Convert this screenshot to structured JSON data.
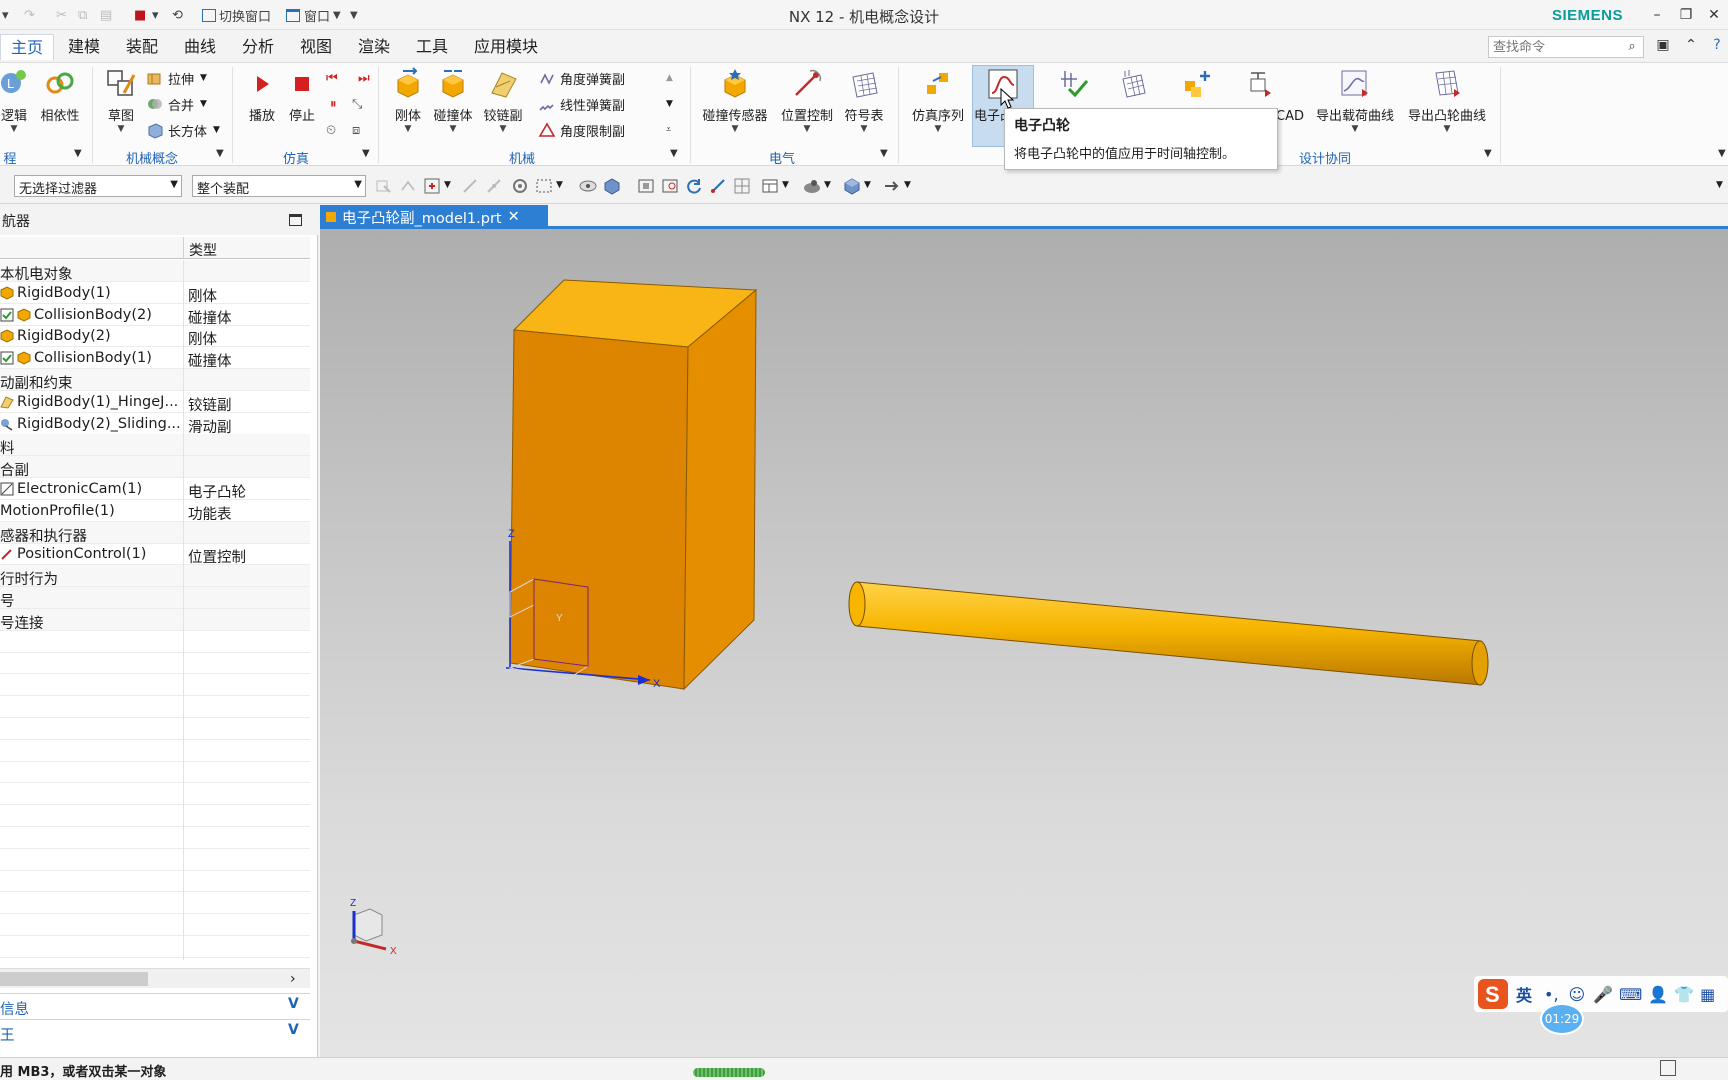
{
  "titlebar": {
    "app_title": "NX 12 - 机电概念设计",
    "brand": "SIEMENS",
    "switch_window_label": "切换窗口",
    "window_menu_label": "窗口"
  },
  "menu": {
    "tabs": [
      "主页",
      "建模",
      "装配",
      "曲线",
      "分析",
      "视图",
      "渲染",
      "工具",
      "应用模块"
    ],
    "active": "主页",
    "search_placeholder": "查找命令"
  },
  "ribbon": {
    "logic_label": "逻辑",
    "coupling_label": "相依性",
    "group_process": "程",
    "sketch_label": "草图",
    "extrude_label": "拉伸",
    "unite_label": "合并",
    "block_label": "长方体",
    "group_mech_concept": "机械概念",
    "play_label": "播放",
    "stop_label": "停止",
    "group_sim": "仿真",
    "rigid_label": "刚体",
    "collision_label": "碰撞体",
    "hinge_label": "铰链副",
    "angular_spring_label": "角度弹簧副",
    "linear_spring_label": "线性弹簧副",
    "angle_limit_label": "角度限制副",
    "group_mech": "机械",
    "collision_sensor_label": "碰撞传感器",
    "position_control_label": "位置控制",
    "symbol_table_label": "符号表",
    "group_elec": "电气",
    "sim_sequence_label": "仿真序列",
    "electronic_cam_label": "电子凸轮",
    "cad_label": "CAD",
    "export_load_curve_label": "导出载荷曲线",
    "export_cam_curve_label": "导出凸轮曲线",
    "group_design_collab": "设计协同"
  },
  "tooltip": {
    "title": "电子凸轮",
    "text": "将电子凸轮中的值应用于时间轴控制。"
  },
  "filterbar": {
    "filter_value": "无选择过滤器",
    "scope_value": "整个装配"
  },
  "navigator": {
    "title": "航器",
    "col_type": "类型",
    "rows": [
      {
        "name": "本机电对象",
        "type": "",
        "kind": "group"
      },
      {
        "name": "RigidBody(1)",
        "type": "刚体",
        "kind": "rigid"
      },
      {
        "name": "CollisionBody(2)",
        "type": "碰撞体",
        "kind": "collision"
      },
      {
        "name": "RigidBody(2)",
        "type": "刚体",
        "kind": "rigid"
      },
      {
        "name": "CollisionBody(1)",
        "type": "碰撞体",
        "kind": "collision"
      },
      {
        "name": "动副和约束",
        "type": "",
        "kind": "group"
      },
      {
        "name": "RigidBody(1)_HingeJ...",
        "type": "铰链副",
        "kind": "hinge"
      },
      {
        "name": "RigidBody(2)_Sliding...",
        "type": "滑动副",
        "kind": "slide"
      },
      {
        "name": "料",
        "type": "",
        "kind": "group"
      },
      {
        "name": "合副",
        "type": "",
        "kind": "group"
      },
      {
        "name": "ElectronicCam(1)",
        "type": "电子凸轮",
        "kind": "cam"
      },
      {
        "name": "MotionProfile(1)",
        "type": "功能表",
        "kind": "plain"
      },
      {
        "name": "感器和执行器",
        "type": "",
        "kind": "group"
      },
      {
        "name": "PositionControl(1)",
        "type": "位置控制",
        "kind": "pos"
      },
      {
        "name": "行时行为",
        "type": "",
        "kind": "group"
      },
      {
        "name": "号",
        "type": "",
        "kind": "group"
      },
      {
        "name": "号连接",
        "type": "",
        "kind": "group"
      }
    ],
    "section_info": "信息",
    "section_other": "王"
  },
  "document": {
    "tab_label": "电子凸轮副_model1.prt"
  },
  "viewport": {
    "triad_x": "X",
    "triad_y": "Y",
    "triad_z": "Z"
  },
  "statusbar": {
    "text": "用 MB3，或者双击某一对象",
    "progress": 1.0
  },
  "ime": {
    "lang": "英",
    "time": "01:29"
  },
  "colors": {
    "accent": "#2d7fd3",
    "brand": "#0a9b9b",
    "model_orange": "#f2a800"
  }
}
